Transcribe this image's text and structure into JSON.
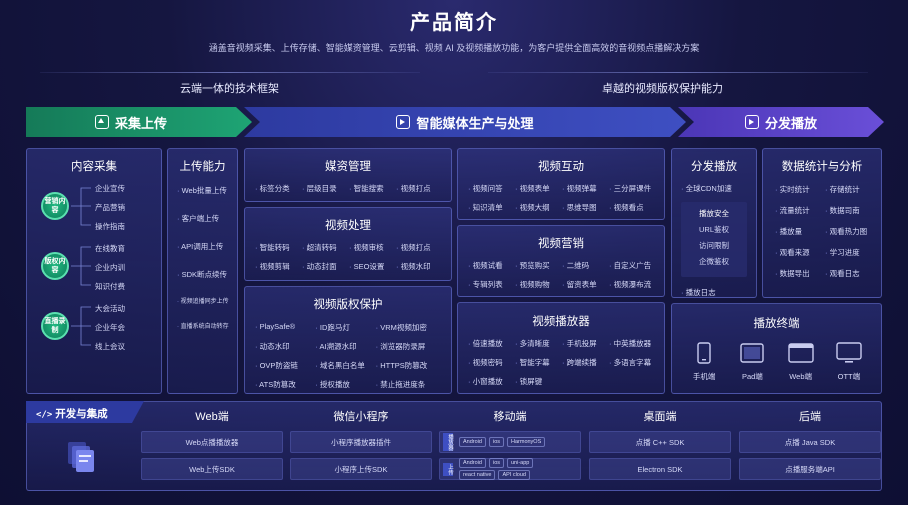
{
  "page": {
    "title": "产品简介",
    "subtitle": "涵盖音视频采集、上传存储、智能媒资管理、云剪辑、视频 AI 及视频播放功能，为客户提供全面高效的音视频点播解决方案"
  },
  "sections": {
    "left": "云端一体的技术框架",
    "right": "卓越的视频版权保护能力"
  },
  "banners": {
    "capture": "采集上传",
    "produce": "智能媒体生产与处理",
    "play": "分发播放"
  },
  "content_capture": {
    "title": "内容采集",
    "groups": [
      {
        "badge": "营销内容",
        "items": [
          "企业宣传",
          "产品营销",
          "操作指南"
        ]
      },
      {
        "badge": "版权内容",
        "items": [
          "在线教育",
          "企业内训",
          "知识付费"
        ]
      },
      {
        "badge": "直播录制",
        "items": [
          "大会活动",
          "企业年会",
          "线上会议"
        ]
      }
    ]
  },
  "upload": {
    "title": "上传能力",
    "items": [
      "Web批量上传",
      "客户端上传",
      "API调用上传",
      "SDK断点续传",
      "视频追播同步上传",
      "直播系统自动转存"
    ]
  },
  "media_mgmt": {
    "title": "媒资管理",
    "items": [
      "标签分类",
      "层级目录",
      "智能搜索",
      "视频打点"
    ]
  },
  "video_proc": {
    "title": "视频处理",
    "items": [
      "智能转码",
      "超清转码",
      "视频审核",
      "视频打点",
      "视频剪辑",
      "动态封面",
      "SEO设置",
      "视频水印"
    ]
  },
  "copyright": {
    "title": "视频版权保护",
    "items": [
      "PlaySafe®",
      "ID跑马灯",
      "VRM视频加密",
      "动态水印",
      "AI溯源水印",
      "浏览器防录屏",
      "OVP防盗链",
      "域名黑白名单",
      "HTTPS防篡改",
      "ATS防篡改",
      "授权播放",
      "禁止拖进度条"
    ]
  },
  "interaction": {
    "title": "视频互动",
    "items": [
      "视频问答",
      "视频表单",
      "视频弹幕",
      "三分屏课件",
      "知识清单",
      "视频大纲",
      "思维导图",
      "视频看点"
    ]
  },
  "marketing": {
    "title": "视频营销",
    "items": [
      "视频试看",
      "预览购买",
      "二维码",
      "自定义广告",
      "专辑列表",
      "视频购物",
      "留资表单",
      "视频瀑布流"
    ]
  },
  "player": {
    "title": "视频播放器",
    "items": [
      "倍速播放",
      "多清晰度",
      "手机投屏",
      "中英播放器",
      "视频密码",
      "智能字幕",
      "跨端续播",
      "多语言字幕",
      "小窗播放",
      "锁屏键"
    ]
  },
  "distribute": {
    "title": "分发播放",
    "cdn": "全球CDN加速",
    "security_title": "播放安全",
    "security_items": [
      "URL鉴权",
      "访问限制",
      "企微鉴权"
    ],
    "log": "播放日志"
  },
  "stats": {
    "title": "数据统计与分析",
    "items": [
      "实时统计",
      "存储统计",
      "流量统计",
      "数据司南",
      "播放量",
      "观看热力图",
      "观看来源",
      "学习进度",
      "数据导出",
      "观看日志"
    ]
  },
  "terminals": {
    "title": "播放终端",
    "items": [
      {
        "label": "手机端",
        "icon": "phone-icon"
      },
      {
        "label": "Pad端",
        "icon": "tablet-icon"
      },
      {
        "label": "Web端",
        "icon": "browser-icon"
      },
      {
        "label": "OTT端",
        "icon": "tv-icon"
      }
    ]
  },
  "devkit": {
    "title": "开发与集成",
    "columns": [
      {
        "title": "Web端",
        "items": [
          "Web点播播放器",
          "Web上传SDK"
        ]
      },
      {
        "title": "微信小程序",
        "items": [
          "小程序播放器插件",
          "小程序上传SDK"
        ]
      },
      {
        "title": "移动端",
        "rows": [
          {
            "label": "播放器",
            "tags": [
              "Android",
              "ios",
              "HarmonyOS"
            ]
          },
          {
            "label": "上传",
            "tags": [
              "Android",
              "ios",
              "uni-app",
              "react native",
              "API cloud"
            ]
          }
        ]
      },
      {
        "title": "桌面端",
        "items": [
          "点播 C++ SDK",
          "Electron SDK"
        ]
      },
      {
        "title": "后端",
        "items": [
          "点播 Java SDK",
          "点播服务端API"
        ]
      }
    ]
  },
  "colors": {
    "accent_green": "#1e9f6e",
    "accent_purple": "#6a4fd8",
    "bg": "#151640"
  }
}
